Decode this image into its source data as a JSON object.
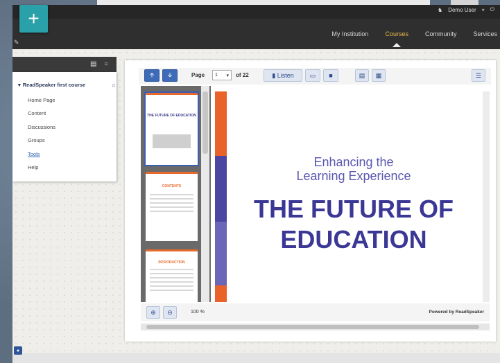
{
  "header": {
    "user_name": "Demo User",
    "nav": [
      "My Institution",
      "Courses",
      "Community",
      "Services"
    ],
    "active_nav": "Courses"
  },
  "course_menu": {
    "title": "ReadSpeaker first course",
    "items": [
      "Home Page",
      "Content",
      "Discussions",
      "Groups",
      "Tools",
      "Help"
    ]
  },
  "viewer": {
    "page_label": "Page",
    "page_value": "1",
    "of_label": "of 22",
    "listen_label": "Listen",
    "zoom_level": "100 %",
    "powered_by": "Powered by ReadSpeaker"
  },
  "thumbnails": [
    {
      "title": "THE FUTURE OF EDUCATION",
      "selected": true
    },
    {
      "title": "CONTENTS",
      "selected": false
    },
    {
      "title": "INTRODUCTION",
      "selected": false
    }
  ],
  "document": {
    "subtitle_line1": "Enhancing the",
    "subtitle_line2": "Learning Experience",
    "title_line1": "THE FUTURE OF",
    "title_line2": "EDUCATION"
  },
  "colors": {
    "accent_orange": "#e8622a",
    "accent_purple": "#4b46a2",
    "nav_active": "#e8b94a",
    "logo_teal": "#2aa0a8"
  }
}
